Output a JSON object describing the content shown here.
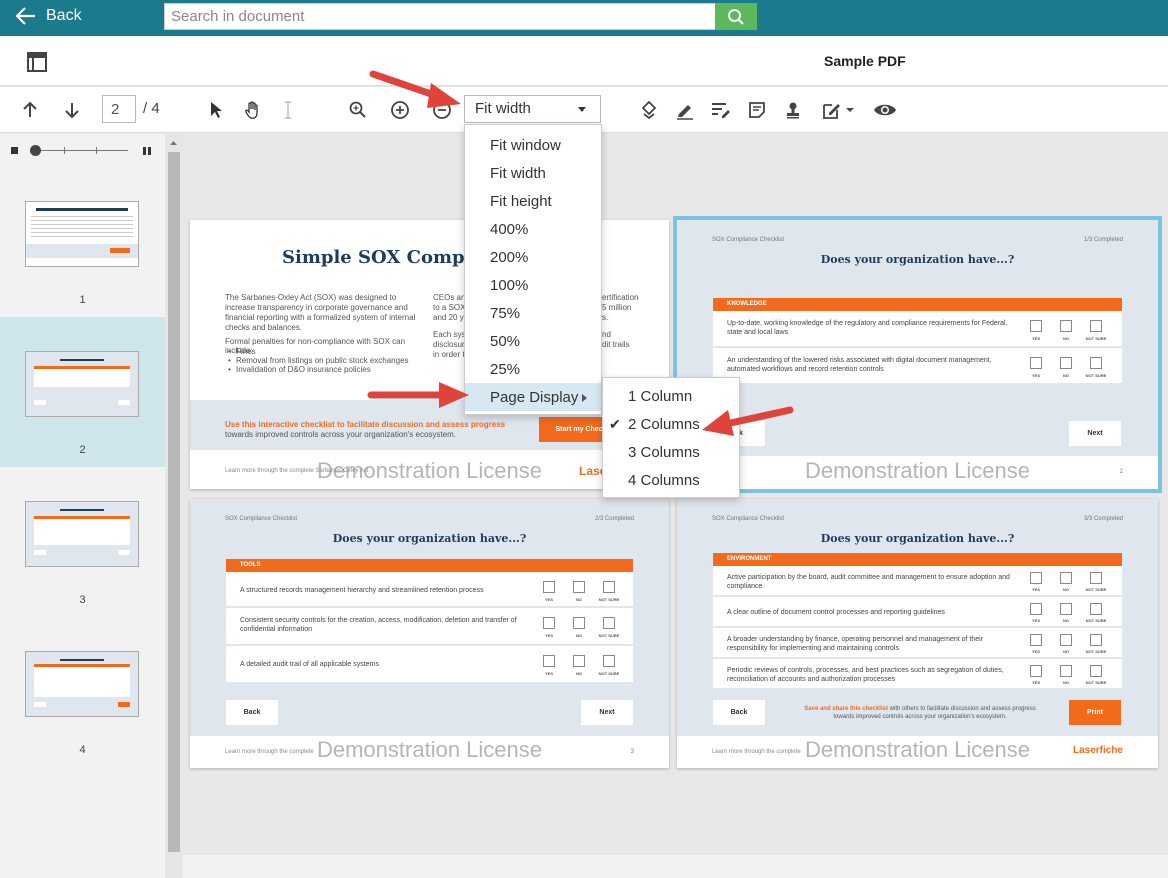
{
  "topbar": {
    "back_label": "Back",
    "search_placeholder": "Search in document"
  },
  "header": {
    "title": "Sample PDF"
  },
  "toolbar": {
    "page_current": "2",
    "page_total": "/ 4",
    "zoom_value": "Fit width"
  },
  "zoom_menu": {
    "items": [
      "Fit window",
      "Fit width",
      "Fit height",
      "400%",
      "200%",
      "100%",
      "75%",
      "50%",
      "25%"
    ],
    "page_display_label": "Page Display"
  },
  "page_display_menu": {
    "items": [
      "1 Column",
      "2 Columns",
      "3 Columns",
      "4 Columns"
    ],
    "selected": "2 Columns"
  },
  "thumbnails": [
    {
      "num": "1"
    },
    {
      "num": "2",
      "active": true
    },
    {
      "num": "3"
    },
    {
      "num": "4"
    }
  ],
  "pages": {
    "p1": {
      "title": "Simple SOX Complia",
      "para1": "The Sarbanes-Oxley Act (SOX) was designed to increase transparency in corporate governance and financial reporting with a formalized system of internal checks and balances.",
      "para2": "Formal penalties for non-compliance with SOX can include:",
      "bullets": [
        "Fines",
        "Removal from listings on public stock exchanges",
        "Invalidation of D&O insurance policies"
      ],
      "col2a": "CEOs and",
      "col2b": "to a SOX c",
      "col2c": "and 20 ye",
      "col2d": "Each syst",
      "col2e": "disclosur",
      "col2f": "in order t",
      "col3a": "ertification",
      "col3b": "5 million",
      "col3c": "s.",
      "col3d": "nd",
      "col3e": "dit trails",
      "cta_orange": "Use this interactive checklist to facilitate discussion and assess progress",
      "cta_rest": " towards improved controls across your organization's ecosystem.",
      "start_btn": "Start my Chec",
      "footer": "Learn more through the complete Sarbanes-Oxley Act",
      "brand": "Laser",
      "watermark": "Demonstration License"
    },
    "p2": {
      "header_left": "SOX Compliance Checklist",
      "header_right": "1/3 Completed",
      "title": "Does your organization have...?",
      "section": "KNOWLEDGE",
      "questions": [
        "Up-to-date, working knowledge of the regulatory and compliance requirements for Federal, state and local laws",
        "An understanding of the lowered risks associated with digital document management, automated workflows and record retention controls"
      ],
      "back": "ck",
      "next": "Next",
      "footer_num": "2",
      "watermark": "Demonstration License"
    },
    "p3": {
      "header_left": "SOX Compliance Checklist",
      "header_right": "2/3 Completed",
      "title": "Does your organization have...?",
      "section": "TOOLS",
      "questions": [
        "A structured records management hierarchy and streamlined retention process",
        "Consistent security controls for the creation, access, modification, deletion and transfer of confidential information",
        "A detailed audit trail of all applicable systems"
      ],
      "back": "Back",
      "next": "Next",
      "footer": "Learn more through the complete",
      "footer_num": "3",
      "watermark": "Demonstration License"
    },
    "p4": {
      "header_left": "SOX Compliance Checklist",
      "header_right": "3/3 Completed",
      "title": "Does your organization have...?",
      "section": "ENVIRONMENT",
      "questions": [
        "Active participation by the board, audit committee and management to ensure adoption and compliance",
        "A clear outline of document control processes and reporting guidelines",
        "A broader understanding by finance, operating personnel and management of their responsibility for implementing and maintaining controls",
        "Periodic reviews of controls, processes, and best practices such as segregation of duties, reconciliation of accounts and authorization processes"
      ],
      "share_orange": "Save and share this checklist",
      "share_rest": " with others to facilitate discussion and assess progress towards improved controls across your organization's ecosystem.",
      "back": "Back",
      "print": "Print",
      "footer": "Learn more through the complete",
      "brand": "Laserfiche",
      "watermark": "Demonstration License"
    },
    "check_labels": {
      "yes": "YES",
      "no": "NO",
      "not_sure": "NOT SURE"
    }
  },
  "colors": {
    "topbar": "#1b7a8c",
    "search_button": "#5cb85c",
    "accent_orange": "#f26b1d",
    "selected_outline": "#7cc3e0",
    "annotation_arrow": "#e0433a"
  }
}
